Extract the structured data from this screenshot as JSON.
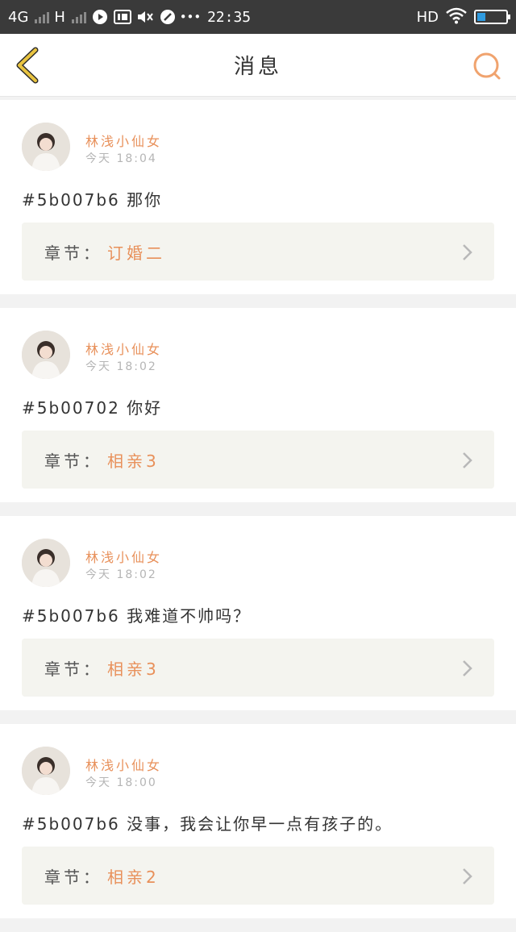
{
  "status_bar": {
    "network_1": "4G",
    "network_2": "H",
    "time": "22:35",
    "hd": "HD"
  },
  "header": {
    "title": "消息"
  },
  "colors": {
    "accent": "#e8905a",
    "back_icon": "#e9c441"
  },
  "messages": [
    {
      "user": "林浅小仙女",
      "time": "今天 18:04",
      "text": "#5b007b6 那你",
      "chapter_label": "章节：",
      "chapter_name": "订婚二"
    },
    {
      "user": "林浅小仙女",
      "time": "今天 18:02",
      "text": "#5b00702 你好",
      "chapter_label": "章节：",
      "chapter_name": "相亲3"
    },
    {
      "user": "林浅小仙女",
      "time": "今天 18:02",
      "text": "#5b007b6 我难道不帅吗？",
      "chapter_label": "章节：",
      "chapter_name": "相亲3"
    },
    {
      "user": "林浅小仙女",
      "time": "今天 18:00",
      "text": "#5b007b6 没事，我会让你早一点有孩子的。",
      "chapter_label": "章节：",
      "chapter_name": "相亲2"
    }
  ]
}
